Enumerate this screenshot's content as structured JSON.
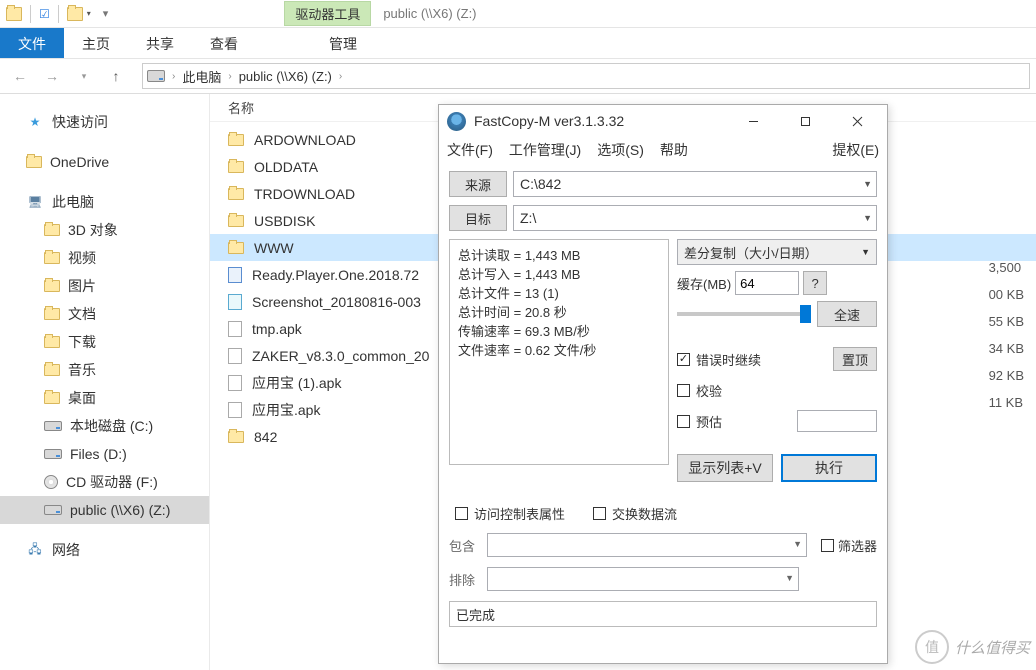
{
  "titlebar": {
    "tools_label": "驱动器工具",
    "path_title": "public (\\\\X6) (Z:)"
  },
  "ribbon": {
    "file": "文件",
    "home": "主页",
    "share": "共享",
    "view": "查看",
    "manage": "管理"
  },
  "breadcrumb": {
    "root": "此电脑",
    "current": "public (\\\\X6) (Z:)"
  },
  "sidebar": {
    "quick_access": "快速访问",
    "onedrive": "OneDrive",
    "this_pc": "此电脑",
    "items": [
      "3D 对象",
      "视频",
      "图片",
      "文档",
      "下载",
      "音乐",
      "桌面",
      "本地磁盘 (C:)",
      "Files (D:)",
      "CD 驱动器 (F:)",
      "public (\\\\X6) (Z:)"
    ],
    "network": "网络"
  },
  "content": {
    "col_name": "名称",
    "rows": [
      {
        "type": "folder",
        "name": "ARDOWNLOAD"
      },
      {
        "type": "folder",
        "name": "OLDDATA"
      },
      {
        "type": "folder",
        "name": "TRDOWNLOAD"
      },
      {
        "type": "folder",
        "name": "USBDISK"
      },
      {
        "type": "folder",
        "name": "WWW",
        "selected": true
      },
      {
        "type": "video",
        "name": "Ready.Player.One.2018.72"
      },
      {
        "type": "image",
        "name": "Screenshot_20180816-003"
      },
      {
        "type": "file",
        "name": "tmp.apk"
      },
      {
        "type": "file",
        "name": "ZAKER_v8.3.0_common_20"
      },
      {
        "type": "file",
        "name": "应用宝 (1).apk"
      },
      {
        "type": "file",
        "name": "应用宝.apk"
      },
      {
        "type": "folder",
        "name": "842"
      }
    ],
    "sizes": [
      "3,500",
      "00 KB",
      "55 KB",
      "34 KB",
      "92 KB",
      "11 KB"
    ]
  },
  "dialog": {
    "title": "FastCopy-M ver3.1.3.32",
    "menu": {
      "file": "文件(F)",
      "job": "工作管理(J)",
      "options": "选项(S)",
      "help": "帮助",
      "auth": "提权(E)"
    },
    "source_label": "来源",
    "source_value": "C:\\842",
    "dest_label": "目标",
    "dest_value": "Z:\\",
    "stats": {
      "read": "总计读取 = 1,443 MB",
      "write": "总计写入 = 1,443 MB",
      "files": "总计文件 = 13 (1)",
      "time": "总计时间 = 20.8 秒",
      "rate": "传输速率 = 69.3 MB/秒",
      "frate": "文件速率 = 0.62 文件/秒"
    },
    "mode": "差分复制（大小/日期）",
    "buffer_label": "缓存(MB)",
    "buffer_value": "64",
    "question": "?",
    "fullspeed": "全速",
    "continue_on_error": "错误时继续",
    "verify": "校验",
    "estimate": "预估",
    "top_btn": "置顶",
    "showlist": "显示列表+V",
    "execute": "执行",
    "acl": "访问控制表属性",
    "ads": "交换数据流",
    "include": "包含",
    "exclude": "排除",
    "filter": "筛选器",
    "status": "已完成"
  },
  "watermark": {
    "text": "什么值得买",
    "badge": "值"
  }
}
